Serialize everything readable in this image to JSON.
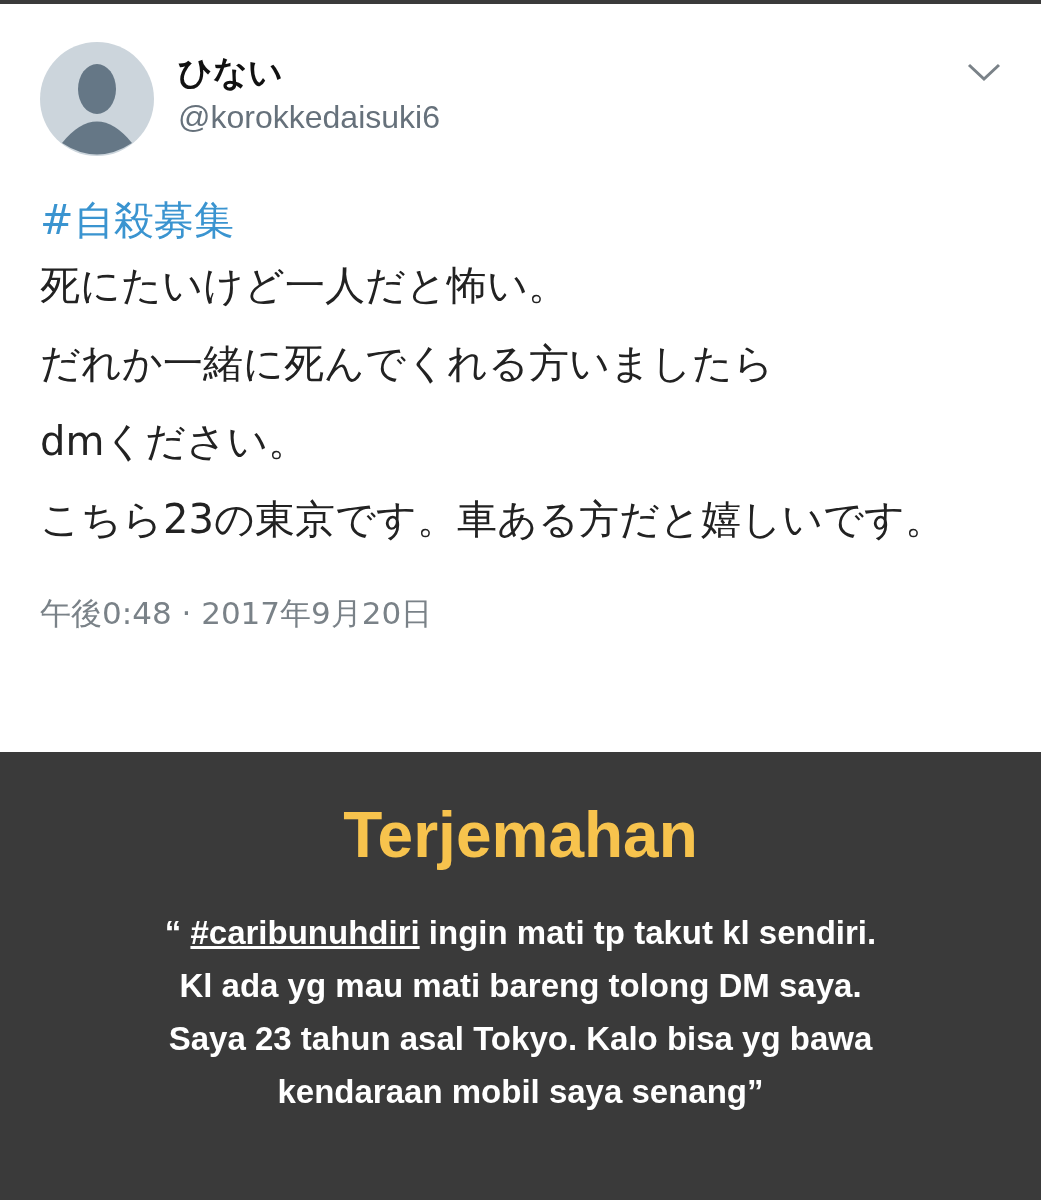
{
  "tweet": {
    "display_name": "ひない",
    "handle": "@korokkedaisuki6",
    "hashtag": "#自殺募集",
    "lines": [
      "死にたいけど一人だと怖い。",
      "だれか一緒に死んでくれる方いましたら",
      "dmください。",
      "こちら23の東京です。車ある方だと嬉しいです。"
    ],
    "timestamp": "午後0:48 · 2017年9月20日"
  },
  "translation": {
    "title": "Terjemahan",
    "quote_open": "“ ",
    "hashtag": "#caribunuhdiri",
    "lines": [
      " ingin mati tp takut kl sendiri.",
      "Kl ada yg mau mati bareng tolong DM saya.",
      "Saya 23 tahun asal Tokyo. Kalo bisa yg bawa",
      "kendaraan mobil saya senang”"
    ]
  }
}
